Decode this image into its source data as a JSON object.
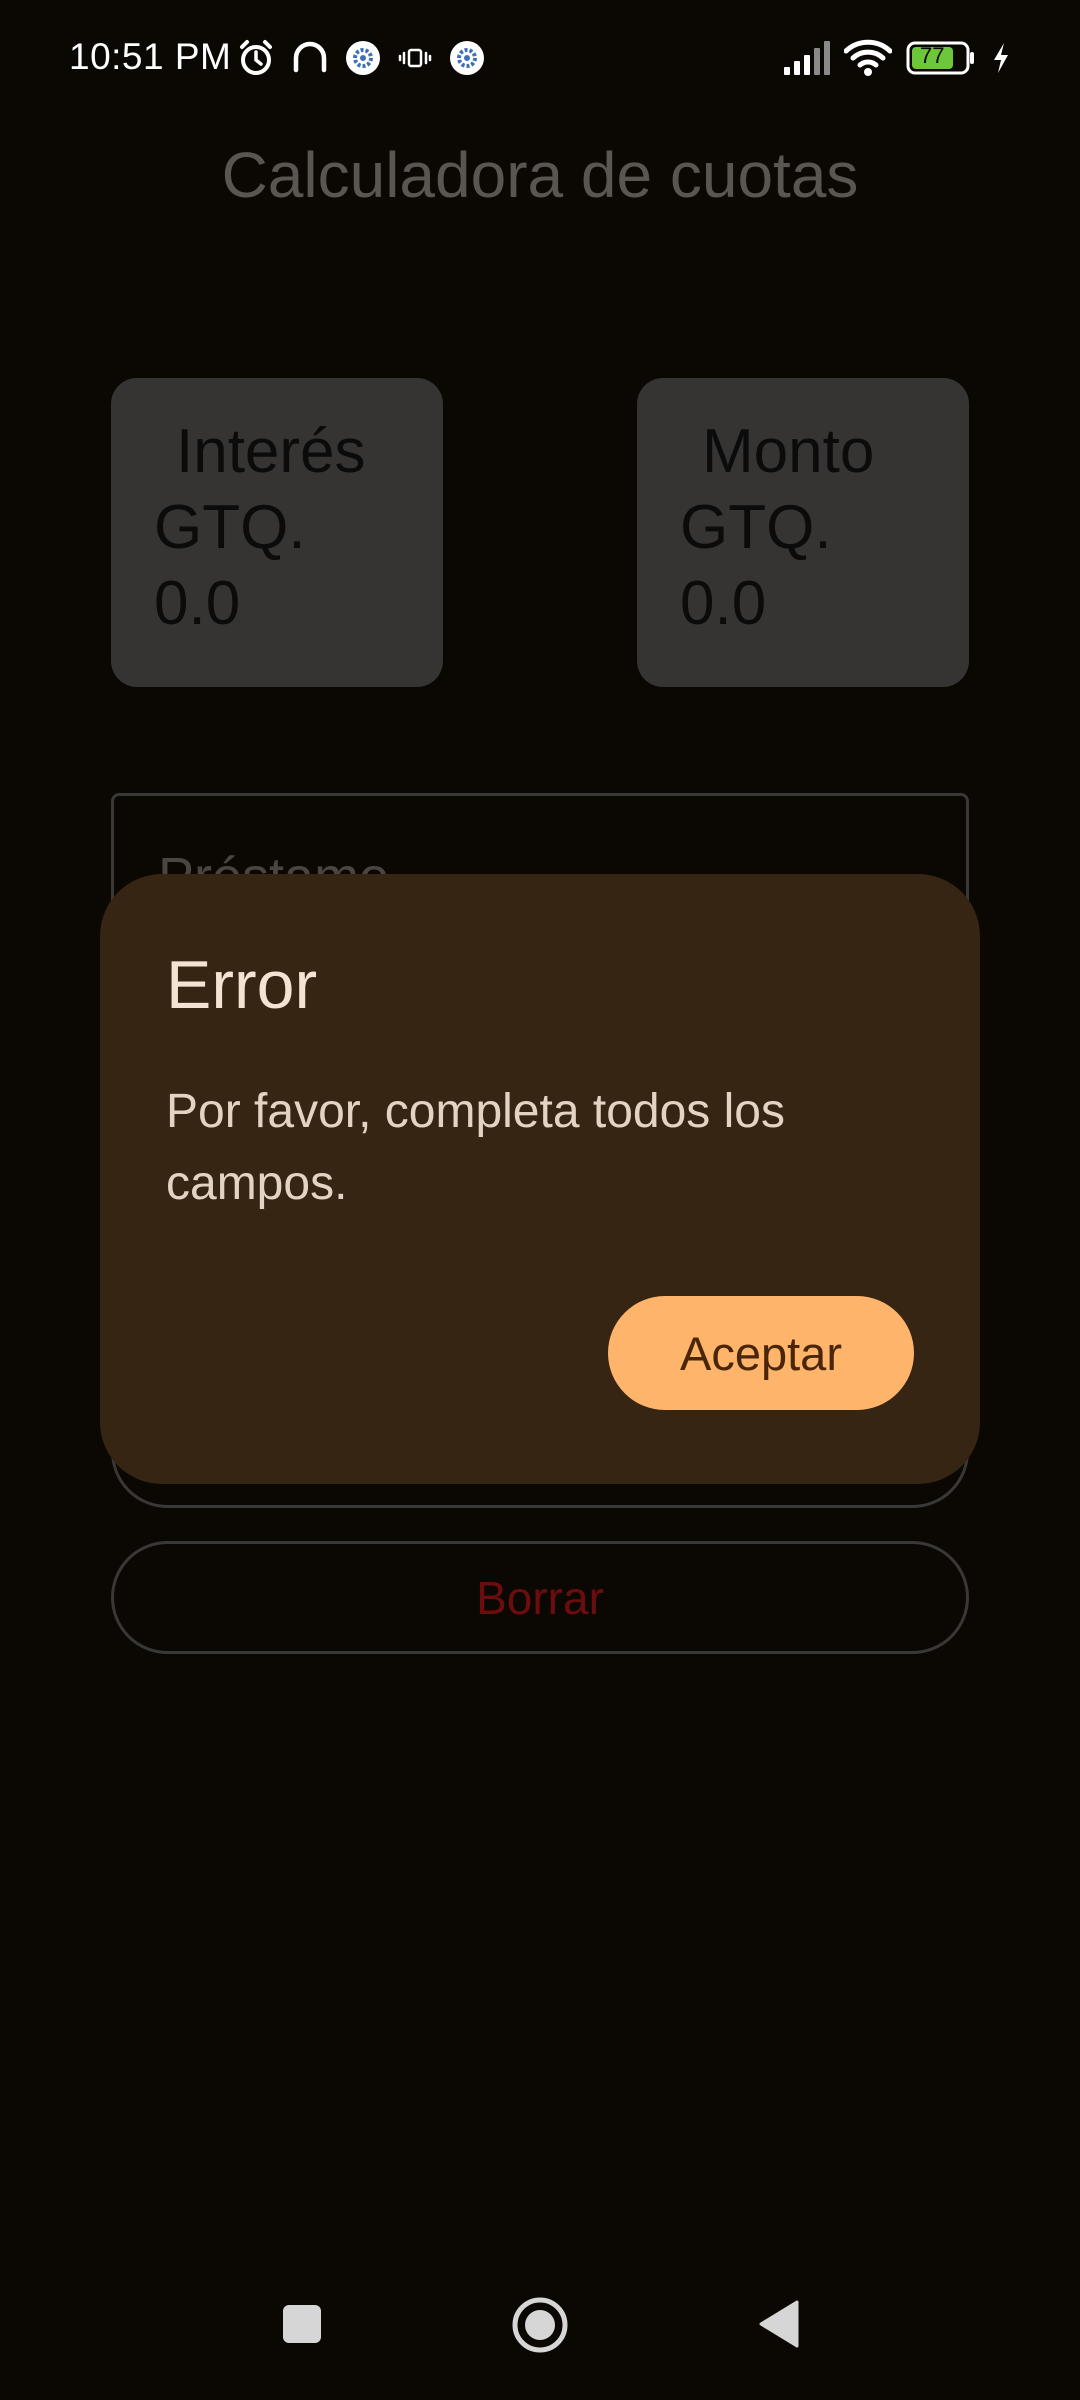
{
  "status_bar": {
    "time": "10:51 PM",
    "battery_level": "77",
    "icons_left": [
      "alarm-icon",
      "headphones-icon",
      "settings-badge-icon",
      "vibrate-icon",
      "settings-badge-icon"
    ],
    "icons_right": [
      "signal-icon",
      "wifi-icon",
      "battery-icon",
      "charging-icon"
    ]
  },
  "app": {
    "title": "Calculadora de cuotas"
  },
  "cards": {
    "interest": {
      "title": "Interés",
      "currency": "GTQ.",
      "value": "0.0"
    },
    "amount": {
      "title": "Monto",
      "currency": "GTQ.",
      "value": "0.0"
    }
  },
  "form": {
    "loan_label": "Préstamo",
    "clear_label": "Borrar"
  },
  "dialog": {
    "title": "Error",
    "message": "Por favor, completa todos los campos.",
    "accept_label": "Aceptar"
  },
  "colors": {
    "background": "#0b0804",
    "card": "#353433",
    "dialog": "#372513",
    "accent_button": "#ffb46b",
    "clear_text": "#6b0d0d"
  },
  "nav_bar": {
    "icons": [
      "recents-icon",
      "home-icon",
      "back-icon"
    ]
  }
}
